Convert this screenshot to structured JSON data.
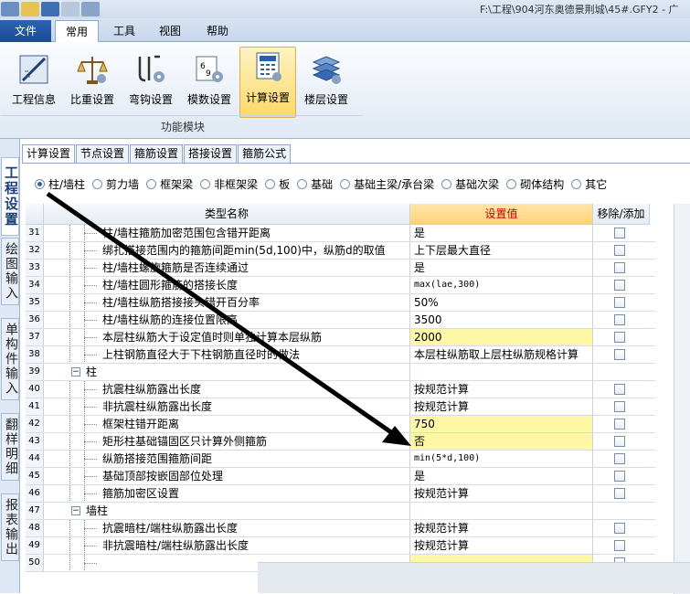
{
  "titlebar": {
    "path_text": "F:\\工程\\904河东奥德景荆城\\45#.GFY2 - 广"
  },
  "ribbon_tabs": {
    "file": "文件",
    "common": "常用",
    "tools": "工具",
    "view": "视图",
    "help": "帮助"
  },
  "ribbon": {
    "buttons": [
      {
        "label": "工程信息",
        "icon": "project-info-icon"
      },
      {
        "label": "比重设置",
        "icon": "scale-settings-icon"
      },
      {
        "label": "弯钩设置",
        "icon": "hook-settings-icon"
      },
      {
        "label": "模数设置",
        "icon": "modulus-settings-icon"
      },
      {
        "label": "计算设置",
        "icon": "calc-settings-icon",
        "active": true
      },
      {
        "label": "楼层设置",
        "icon": "floor-settings-icon"
      }
    ],
    "group_label": "功能模块"
  },
  "left_tabs": [
    "工程设置",
    "绘图输入",
    "单构件输入",
    "翻样明细",
    "报表输出"
  ],
  "sub_tabs": [
    "计算设置",
    "节点设置",
    "箍筋设置",
    "搭接设置",
    "箍筋公式"
  ],
  "radios": [
    {
      "label": "柱/墙柱",
      "selected": true
    },
    {
      "label": "剪力墙",
      "selected": false
    },
    {
      "label": "框架梁",
      "selected": false
    },
    {
      "label": "非框架梁",
      "selected": false
    },
    {
      "label": "板",
      "selected": false
    },
    {
      "label": "基础",
      "selected": false
    },
    {
      "label": "基础主梁/承台梁",
      "selected": false
    },
    {
      "label": "基础次梁",
      "selected": false
    },
    {
      "label": "砌体结构",
      "selected": false
    },
    {
      "label": "其它",
      "selected": false
    }
  ],
  "grid": {
    "headers": {
      "name": "类型名称",
      "value": "设置值",
      "action": "移除/添加"
    },
    "rows": [
      {
        "num": "31",
        "name": "柱/墙柱箍筋加密范围包含错开距离",
        "value": "是",
        "hl": false,
        "mono": false
      },
      {
        "num": "32",
        "name": "绑扎搭接范围内的箍筋间距min(5d,100)中，纵筋d的取值",
        "value": "上下层最大直径",
        "hl": false,
        "mono": false
      },
      {
        "num": "33",
        "name": "柱/墙柱螺旋箍筋是否连续通过",
        "value": "是",
        "hl": false,
        "mono": false
      },
      {
        "num": "34",
        "name": "柱/墙柱圆形箍筋的搭接长度",
        "value": "max(lae,300)",
        "hl": false,
        "mono": true
      },
      {
        "num": "35",
        "name": "柱/墙柱纵筋搭接接头错开百分率",
        "value": "50%",
        "hl": false,
        "mono": false
      },
      {
        "num": "36",
        "name": "柱/墙柱纵筋的连接位置限高",
        "value": "3500",
        "hl": false,
        "mono": false
      },
      {
        "num": "37",
        "name": "本层柱纵筋大于设定值时则单独计算本层纵筋",
        "value": "2000",
        "hl": true,
        "mono": false
      },
      {
        "num": "38",
        "name": "上柱钢筋直径大于下柱钢筋直径时的做法",
        "value": "本层柱纵筋取上层柱纵筋规格计算",
        "hl": false,
        "mono": false
      },
      {
        "num": "39",
        "name": "柱",
        "value": "",
        "group": true
      },
      {
        "num": "40",
        "name": "抗震柱纵筋露出长度",
        "value": "按规范计算",
        "hl": false,
        "mono": false
      },
      {
        "num": "41",
        "name": "非抗震柱纵筋露出长度",
        "value": "按规范计算",
        "hl": false,
        "mono": false
      },
      {
        "num": "42",
        "name": "框架柱错开距离",
        "value": "750",
        "hl": true,
        "mono": false
      },
      {
        "num": "43",
        "name": "矩形柱基础锚固区只计算外侧箍筋",
        "value": "否",
        "hl": true,
        "mono": false
      },
      {
        "num": "44",
        "name": "纵筋搭接范围箍筋间距",
        "value": "min(5*d,100)",
        "hl": false,
        "mono": true
      },
      {
        "num": "45",
        "name": "基础顶部按嵌固部位处理",
        "value": "是",
        "hl": false,
        "mono": false
      },
      {
        "num": "46",
        "name": "箍筋加密区设置",
        "value": "按规范计算",
        "hl": false,
        "mono": false
      },
      {
        "num": "47",
        "name": "墙柱",
        "value": "",
        "group": true
      },
      {
        "num": "48",
        "name": "抗震暗柱/端柱纵筋露出长度",
        "value": "按规范计算",
        "hl": false,
        "mono": false
      },
      {
        "num": "49",
        "name": "非抗震暗柱/端柱纵筋露出长度",
        "value": "按规范计算",
        "hl": false,
        "mono": false
      },
      {
        "num": "50",
        "name": "",
        "value": "",
        "hl": true,
        "mono": false
      }
    ]
  },
  "colors": {
    "accent_header": "#ffd27a",
    "highlight": "#fdf7a6",
    "file_tab": "#1b4b96",
    "header_value_text": "#c00000"
  }
}
